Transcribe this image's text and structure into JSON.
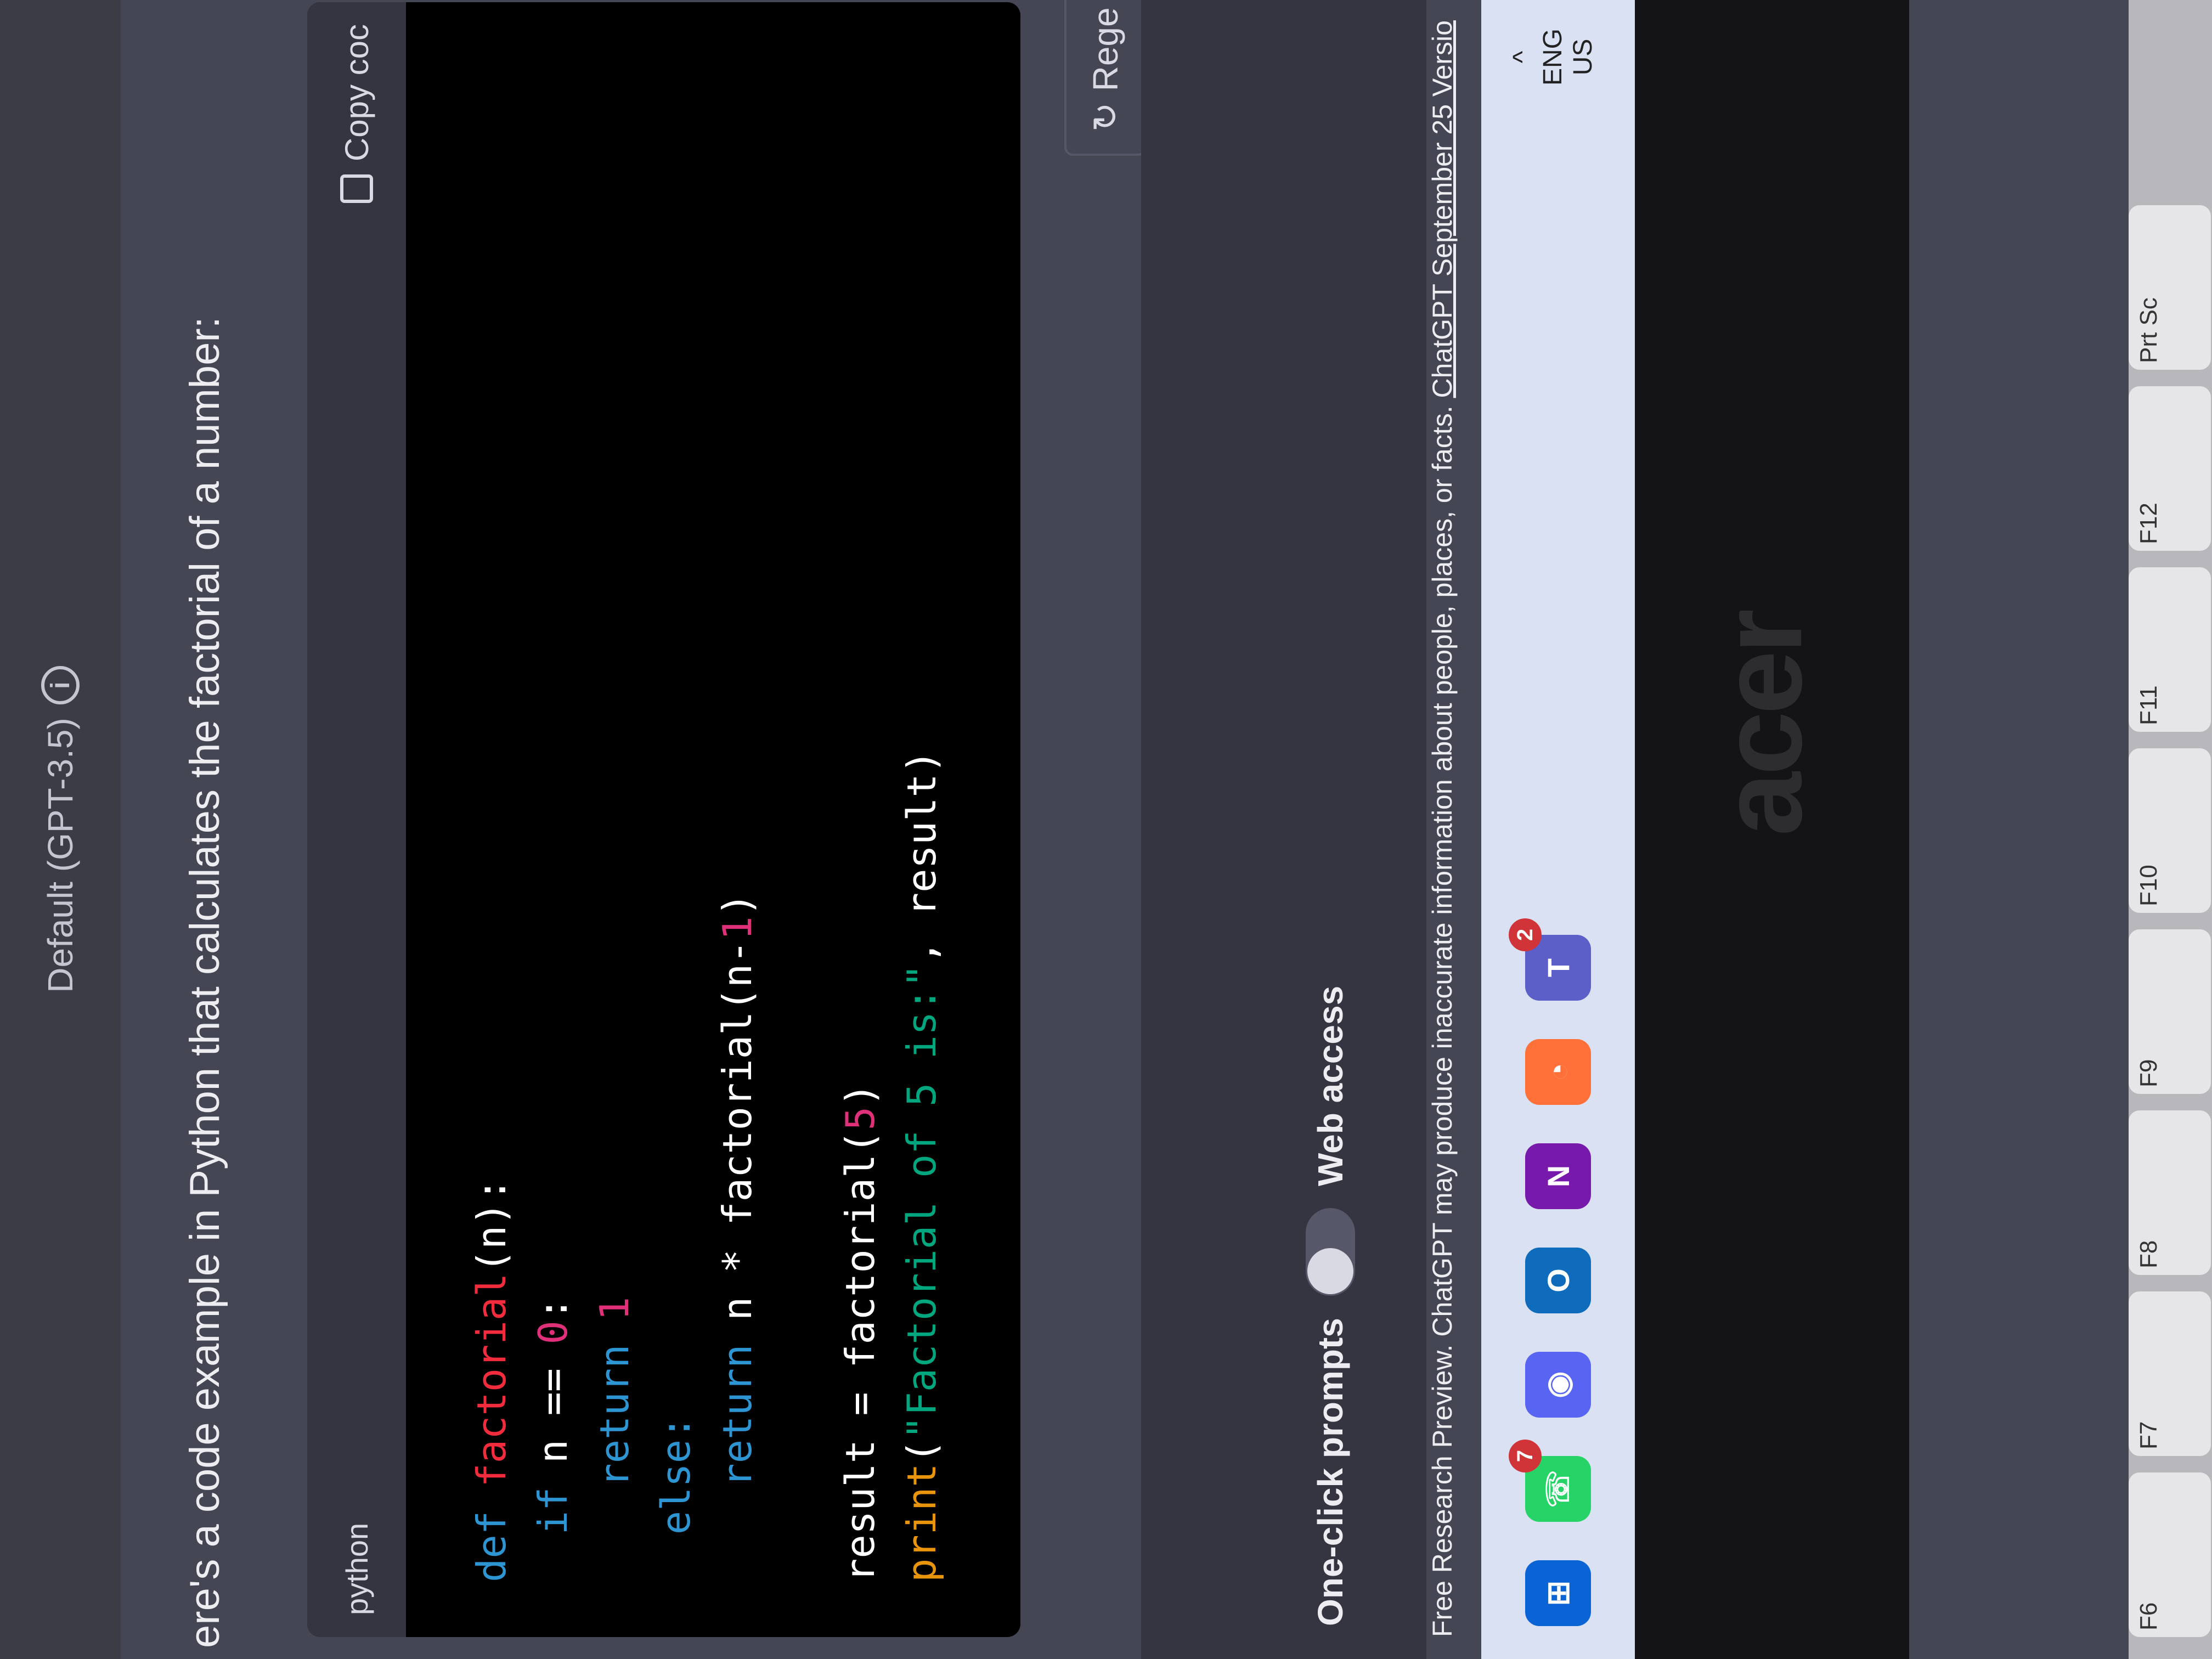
{
  "header": {
    "model_label": "Default (GPT-3.5)",
    "info_icon": "info-icon"
  },
  "message": {
    "intro": "ere's a code example in Python that calculates the factorial of a number:"
  },
  "code": {
    "language": "python",
    "copy_label": "Copy coc",
    "tokens": {
      "def": "def",
      "fname": "factorial",
      "param": "(n):",
      "if": "if",
      "cond": " n == ",
      "zero": "0",
      "colon": ":",
      "ret": "return",
      "one": "1",
      "else": "else:",
      "ret2": "return",
      "mul": " n * ",
      "rec": "factorial",
      "recarg_open": "(n-",
      "recarg_one": "1",
      "recarg_close": ")",
      "res": "result = ",
      "call": "factorial",
      "call_open": "(",
      "five": "5",
      "call_close": ")",
      "print": "print",
      "p_open": "(",
      "str": "\"Factorial of 5 is:\"",
      "p_rest": ", result)"
    }
  },
  "actions": {
    "regenerate_label": "Rege",
    "regen_icon": "refresh-icon"
  },
  "toggles": {
    "one_click": "One-click prompts",
    "web_access": "Web access"
  },
  "footer": {
    "disclaimer": "Free Research Preview. ChatGPT may produce inaccurate information about people, places, or facts. ",
    "version_link": "ChatGPT September 25 Versio"
  },
  "taskbar": {
    "apps": [
      {
        "name": "start-icon",
        "glyph": "⊞",
        "color": "#0a64d6"
      },
      {
        "name": "whatsapp-icon",
        "glyph": "☏",
        "color": "#25d366",
        "badge": "7"
      },
      {
        "name": "discord-icon",
        "glyph": "◉",
        "color": "#5865f2"
      },
      {
        "name": "outlook-icon",
        "glyph": "O",
        "color": "#0f6cbd"
      },
      {
        "name": "onenote-icon",
        "glyph": "N",
        "color": "#7719aa"
      },
      {
        "name": "browser-icon",
        "glyph": "◔",
        "color": "#ff7139"
      },
      {
        "name": "teams-icon",
        "glyph": "T",
        "color": "#5b5fc7",
        "badge": "2"
      }
    ],
    "tray": {
      "lang": "ENG",
      "region": "US",
      "chevron": "^"
    }
  },
  "laptop": {
    "brand": "acer"
  },
  "keyboard": {
    "keys": [
      "F6",
      "F7",
      "F8",
      "F9",
      "F10",
      "F11",
      "F12",
      "Prt Sc"
    ]
  },
  "colors": {
    "page_bg": "#444654",
    "code_bg": "#000000",
    "keyword": "#2e95d3",
    "function": "#f22c3d",
    "number": "#df3079",
    "string": "#00a67d"
  }
}
